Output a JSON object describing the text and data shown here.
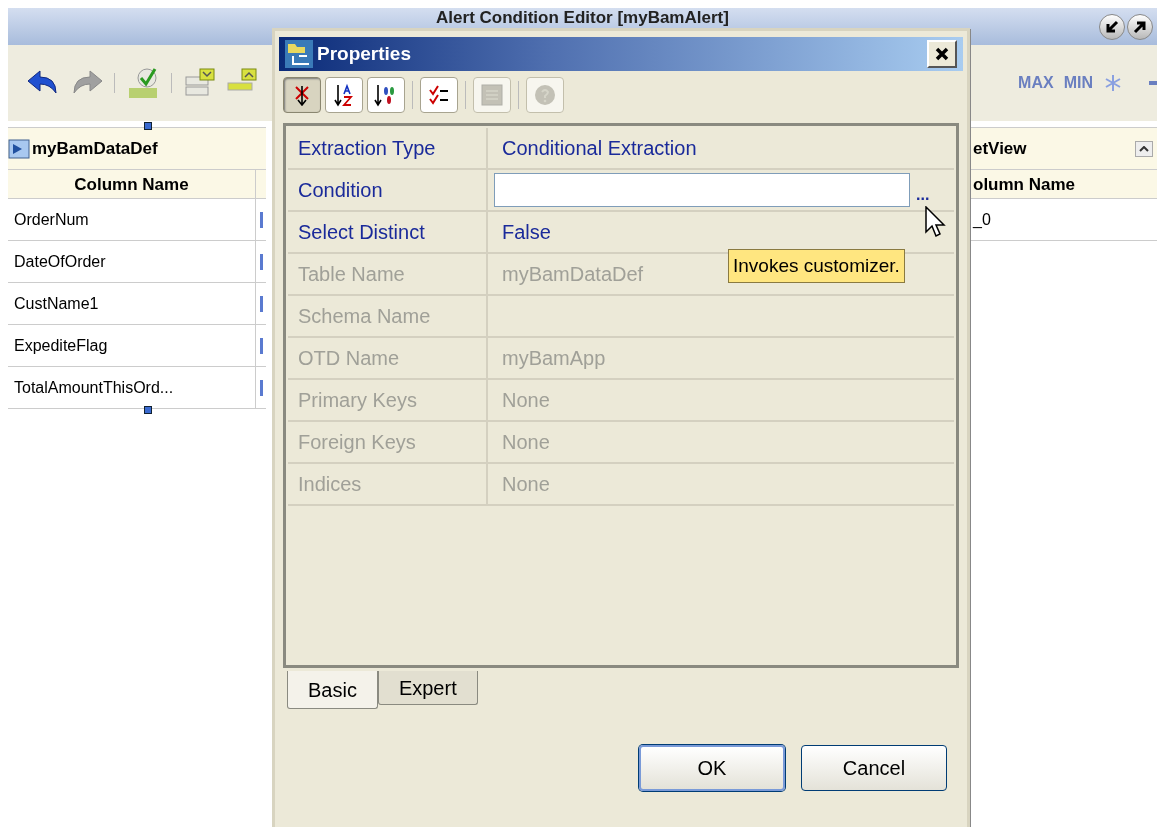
{
  "window": {
    "title": "Alert Condition Editor [myBamAlert]"
  },
  "main_toolbar": {
    "labels": [
      "MAX",
      "MIN"
    ]
  },
  "left_table": {
    "title": "myBamDataDef",
    "column": "Column Name",
    "rows": [
      "OrderNum",
      "DateOfOrder",
      "CustName1",
      "ExpediteFlag",
      "TotalAmountThisOrd..."
    ]
  },
  "right_table": {
    "title": "etView",
    "column": "olumn Name",
    "rows": [
      "_0"
    ]
  },
  "dialog": {
    "title": "Properties",
    "toolbar": [
      {
        "kind": "categorized",
        "selected": true,
        "disabled": false
      },
      {
        "kind": "sort-az",
        "selected": false,
        "disabled": false
      },
      {
        "kind": "sort-kind",
        "selected": false,
        "disabled": false
      },
      {
        "kind": "checklist",
        "selected": false,
        "disabled": false
      },
      {
        "kind": "grid",
        "selected": false,
        "disabled": true
      },
      {
        "kind": "help",
        "selected": false,
        "disabled": true
      }
    ],
    "properties": [
      {
        "name": "Extraction Type",
        "value": "Conditional Extraction",
        "kind": "text",
        "disabled": false
      },
      {
        "name": "Condition",
        "kind": "field",
        "button": "...",
        "disabled": false
      },
      {
        "name": "Select Distinct",
        "value": "False",
        "kind": "text",
        "disabled": false
      },
      {
        "name": "Table Name",
        "value": "myBamDataDef",
        "kind": "text",
        "disabled": true
      },
      {
        "name": "Schema Name",
        "kind": "text",
        "disabled": true
      },
      {
        "name": "OTD Name",
        "value": "myBamApp",
        "kind": "text",
        "disabled": true
      },
      {
        "name": "Primary Keys",
        "value": "None",
        "kind": "text",
        "disabled": true
      },
      {
        "name": "Foreign Keys",
        "value": "None",
        "kind": "text",
        "disabled": true
      },
      {
        "name": "Indices",
        "value": "None",
        "kind": "text",
        "disabled": true
      }
    ],
    "tooltip": "Invokes customizer.",
    "tabs": [
      {
        "label": "Basic",
        "selected": true
      },
      {
        "label": "Expert",
        "selected": false
      }
    ],
    "buttons": [
      {
        "label": "OK",
        "default": true
      },
      {
        "label": "Cancel",
        "default": false
      }
    ]
  }
}
